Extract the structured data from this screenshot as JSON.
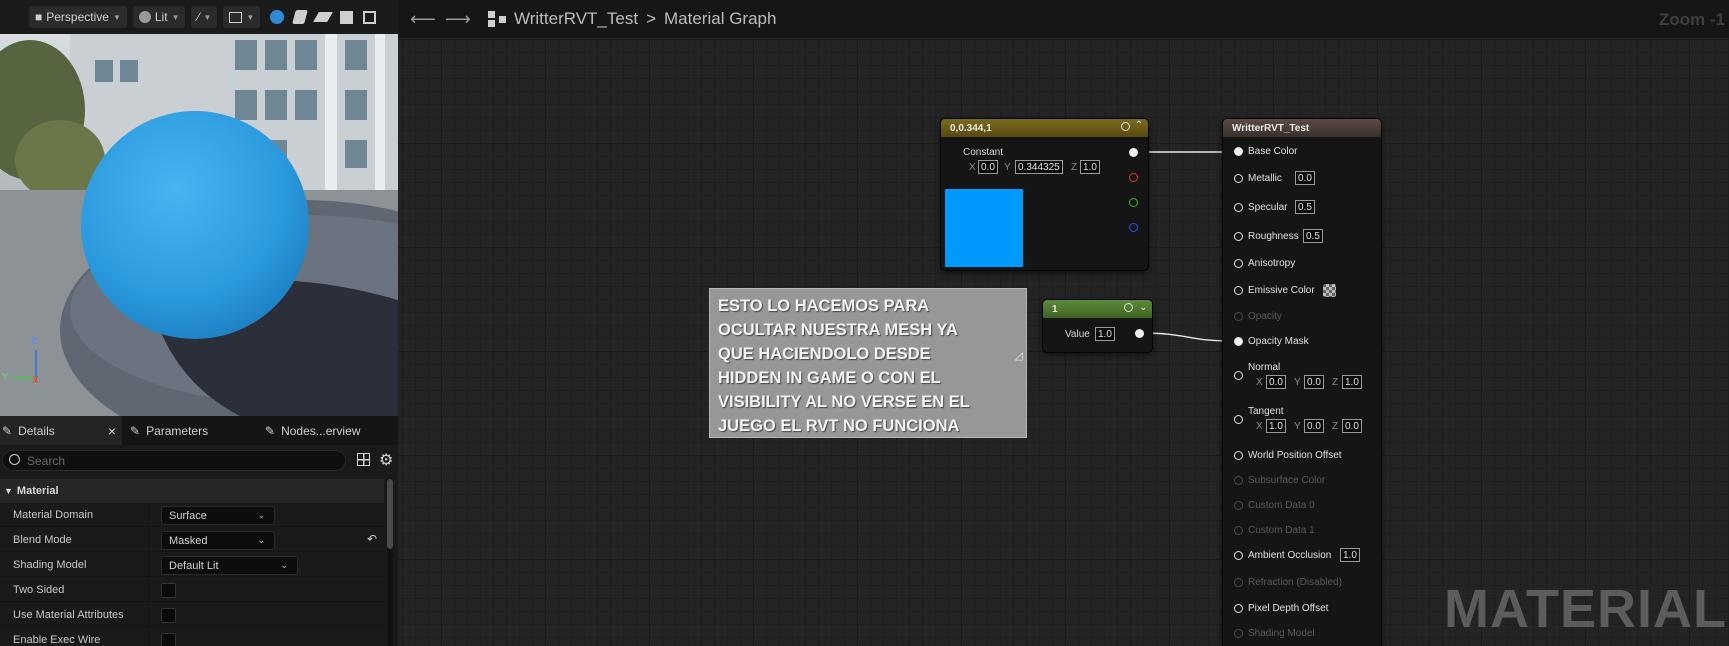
{
  "viewport": {
    "perspective_label": "Perspective",
    "lit_label": "Lit",
    "axis_z": "Z",
    "axis_y": "Y",
    "axis_x": "X"
  },
  "details_tabs": [
    {
      "label": "Details",
      "close": "×"
    },
    {
      "label": "Parameters"
    },
    {
      "label": "Nodes...erview"
    }
  ],
  "search": {
    "placeholder": "Search"
  },
  "material_section": "Material",
  "properties": [
    {
      "label": "Material Domain",
      "value": "Surface"
    },
    {
      "label": "Blend Mode",
      "value": "Masked"
    },
    {
      "label": "Shading Model",
      "value": "Default Lit"
    },
    {
      "label": "Two Sided"
    },
    {
      "label": "Use Material Attributes"
    },
    {
      "label": "Enable Exec Wire"
    }
  ],
  "graph": {
    "asset": "WritterRVT_Test",
    "separator": ">",
    "page": "Material Graph",
    "zoom": "Zoom -1",
    "watermark": "MATERIAL"
  },
  "constant3": {
    "title": "0,0.344,1",
    "label": "Constant",
    "x_label": "X",
    "x": "0.0",
    "y_label": "Y",
    "y": "0.344325",
    "z_label": "Z",
    "z": "1.0",
    "preview_color": "#0099ff"
  },
  "constant1": {
    "title": "1",
    "value_label": "Value",
    "value": "1.0"
  },
  "comment": {
    "text": "ESTO LO HACEMOS PARA\nOCULTAR NUESTRA MESH YA\nQUE HACIENDOLO DESDE\nHIDDEN IN GAME O CON EL\nVISIBILITY AL NO VERSE EN EL\nJUEGO EL RVT NO FUNCIONA"
  },
  "material_node": {
    "title": "WritterRVT_Test",
    "base_color": "Base Color",
    "metallic": "Metallic",
    "metallic_val": "0.0",
    "specular": "Specular",
    "specular_val": "0.5",
    "roughness": "Roughness",
    "roughness_val": "0.5",
    "anisotropy": "Anisotropy",
    "emissive": "Emissive Color",
    "opacity": "Opacity",
    "opacity_mask": "Opacity Mask",
    "normal": "Normal",
    "normal_x": "0.0",
    "normal_y": "0.0",
    "normal_z": "1.0",
    "tangent": "Tangent",
    "tangent_x": "1.0",
    "tangent_y": "0.0",
    "tangent_z": "0.0",
    "x_label": "X",
    "y_label": "Y",
    "z_label": "Z",
    "wpo": "World Position Offset",
    "subsurface": "Subsurface Color",
    "custom0": "Custom Data 0",
    "custom1": "Custom Data 1",
    "ao": "Ambient Occlusion",
    "ao_val": "1.0",
    "refraction": "Refraction (Disabled)",
    "pdo": "Pixel Depth Offset",
    "shading_model": "Shading Model"
  }
}
